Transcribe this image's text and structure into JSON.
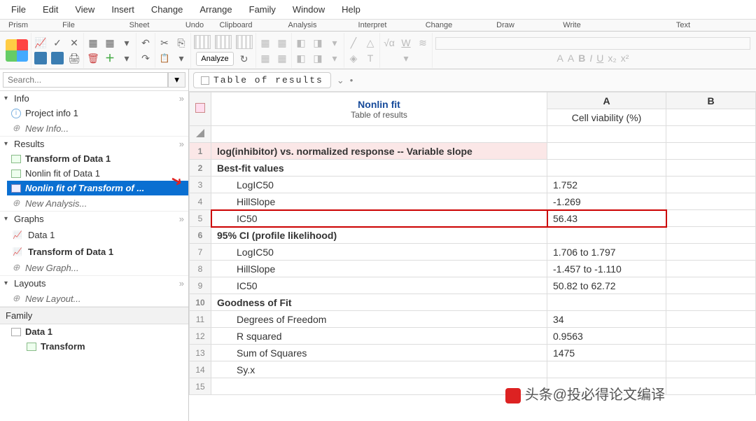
{
  "menu": [
    "File",
    "Edit",
    "View",
    "Insert",
    "Change",
    "Arrange",
    "Family",
    "Window",
    "Help"
  ],
  "ribbon": {
    "prism": "Prism",
    "file": "File",
    "sheet": "Sheet",
    "undo": "Undo",
    "clipboard": "Clipboard",
    "analysis": "Analysis",
    "interpret": "Interpret",
    "change": "Change",
    "draw": "Draw",
    "write": "Write",
    "text": "Text"
  },
  "toolbar": {
    "analyze": "Analyze"
  },
  "search": {
    "placeholder": "Search..."
  },
  "sidebar": {
    "info": {
      "title": "Info",
      "items": [
        {
          "label": "Project info 1"
        },
        {
          "label": "New Info..."
        }
      ]
    },
    "results": {
      "title": "Results",
      "items": [
        {
          "label": "Transform of Data 1",
          "bold": true
        },
        {
          "label": "Nonlin fit of Data 1"
        },
        {
          "label": "Nonlin fit of Transform of ...",
          "selected": true
        },
        {
          "label": "New Analysis...",
          "italic": true
        }
      ]
    },
    "graphs": {
      "title": "Graphs",
      "items": [
        {
          "label": "Data 1"
        },
        {
          "label": "Transform of Data 1",
          "bold": true
        },
        {
          "label": "New Graph...",
          "italic": true
        }
      ]
    },
    "layouts": {
      "title": "Layouts",
      "items": [
        {
          "label": "New Layout...",
          "italic": true
        }
      ]
    },
    "family": {
      "title": "Family",
      "items": [
        {
          "label": "Data 1",
          "bold": true
        },
        {
          "label": "Transform",
          "bold": true,
          "indent": true
        }
      ]
    }
  },
  "tab": {
    "label": "Table of results"
  },
  "table": {
    "heading_title": "Nonlin fit",
    "heading_sub": "Table of results",
    "colA": "A",
    "colB": "B",
    "colA_label": "Cell viability (%)",
    "rows": [
      {
        "n": "1",
        "param": "log(inhibitor) vs. normalized response -- Variable slope",
        "a": "",
        "hdr": true,
        "pink": true
      },
      {
        "n": "2",
        "param": "Best-fit values",
        "a": "",
        "hdr": true
      },
      {
        "n": "3",
        "param": "LogIC50",
        "a": "1.752",
        "indent": true
      },
      {
        "n": "4",
        "param": "HillSlope",
        "a": "-1.269",
        "indent": true
      },
      {
        "n": "5",
        "param": "IC50",
        "a": "56.43",
        "indent": true,
        "hl": true
      },
      {
        "n": "6",
        "param": "95% CI (profile likelihood)",
        "a": "",
        "hdr": true
      },
      {
        "n": "7",
        "param": "LogIC50",
        "a": "1.706 to 1.797",
        "indent": true
      },
      {
        "n": "8",
        "param": "HillSlope",
        "a": "-1.457 to -1.110",
        "indent": true
      },
      {
        "n": "9",
        "param": "IC50",
        "a": "50.82 to 62.72",
        "indent": true
      },
      {
        "n": "10",
        "param": "Goodness of Fit",
        "a": "",
        "hdr": true
      },
      {
        "n": "11",
        "param": "Degrees of Freedom",
        "a": "34",
        "indent": true
      },
      {
        "n": "12",
        "param": "R squared",
        "a": "0.9563",
        "indent": true
      },
      {
        "n": "13",
        "param": "Sum of Squares",
        "a": "1475",
        "indent": true
      },
      {
        "n": "14",
        "param": "Sy.x",
        "a": "",
        "indent": true
      },
      {
        "n": "15",
        "param": "",
        "a": ""
      }
    ]
  },
  "watermark": "头条@投必得论文编译",
  "text_fmt": {
    "bold": "B",
    "italic": "I",
    "underline": "U",
    "sub": "x₂",
    "sup": "x²"
  },
  "write": {
    "sqrt": "√α",
    "w": "W"
  }
}
